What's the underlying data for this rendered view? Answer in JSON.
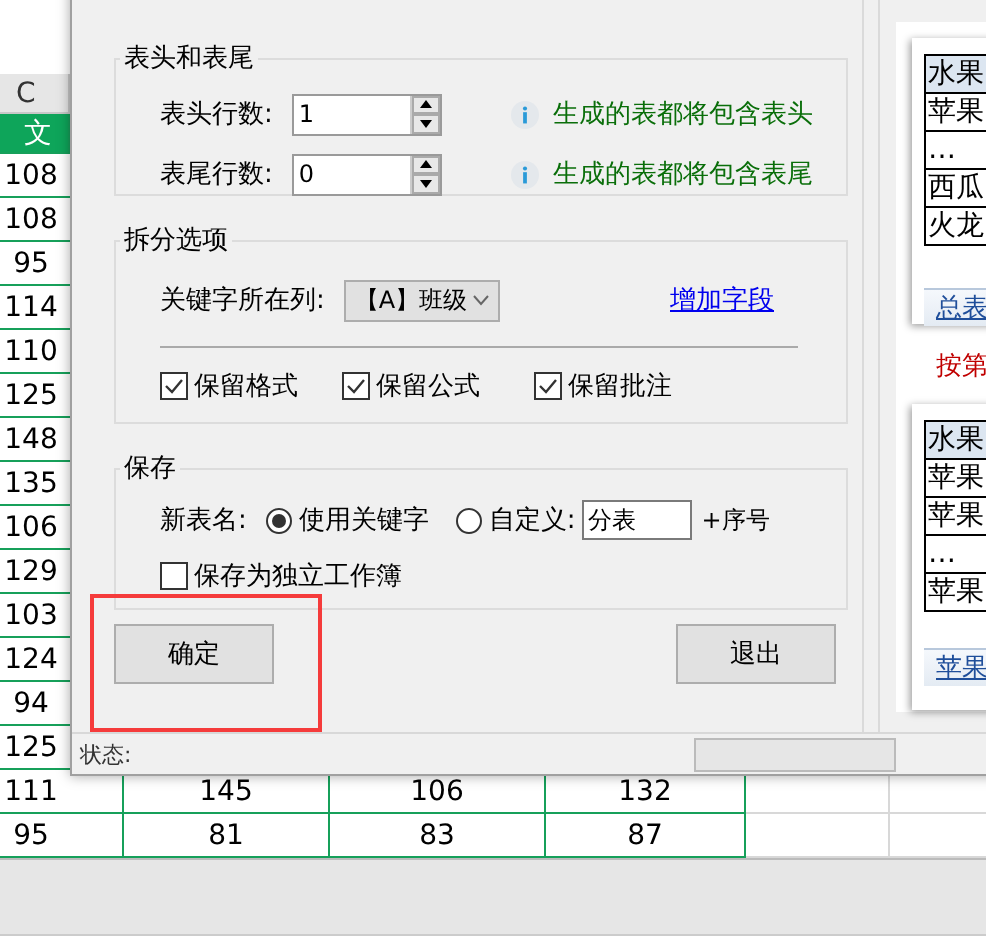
{
  "sheet": {
    "column_header": "C",
    "field_header": "文",
    "rows": [
      [
        "108"
      ],
      [
        "108"
      ],
      [
        "95"
      ],
      [
        "114"
      ],
      [
        "110"
      ],
      [
        "125"
      ],
      [
        "148"
      ],
      [
        "135"
      ],
      [
        "106"
      ],
      [
        "129"
      ],
      [
        "103"
      ],
      [
        "124"
      ],
      [
        "94"
      ],
      [
        "125"
      ],
      [
        "111",
        "145",
        "106",
        "132"
      ],
      [
        "95",
        "81",
        "83",
        "87"
      ]
    ]
  },
  "dialog": {
    "header_footer": {
      "title": "表头和表尾",
      "fields": [
        {
          "label": "表头行数:",
          "value": "1",
          "hint": "生成的表都将包含表头"
        },
        {
          "label": "表尾行数:",
          "value": "0",
          "hint": "生成的表都将包含表尾"
        }
      ]
    },
    "split_options": {
      "title": "拆分选项",
      "key_column_label": "关键字所在列:",
      "key_column": "【A】班级",
      "add_field_link": "增加字段",
      "options": [
        {
          "label": "保留格式",
          "checked": true
        },
        {
          "label": "保留公式",
          "checked": true
        },
        {
          "label": "保留批注",
          "checked": true
        }
      ]
    },
    "save": {
      "title": "保存",
      "name_label": "新表名:",
      "choices": [
        {
          "label": "使用关键字",
          "selected": true
        },
        {
          "label": "自定义:",
          "selected": false
        }
      ],
      "custom_name": "分表",
      "suffix": "+序号",
      "separate_workbook": {
        "label": "保存为独立工作簿",
        "checked": false
      }
    },
    "buttons": [
      "确定",
      "退出"
    ],
    "status_label": "状态:",
    "preview": {
      "cards": [
        {
          "rows": [
            "水果",
            "苹果",
            "…",
            "西瓜",
            "火龙"
          ],
          "tab": "总表"
        },
        {
          "rows": [
            "水果",
            "苹果",
            "苹果",
            "…",
            "苹果"
          ],
          "tab": "苹果"
        }
      ],
      "caption": "按第"
    }
  }
}
